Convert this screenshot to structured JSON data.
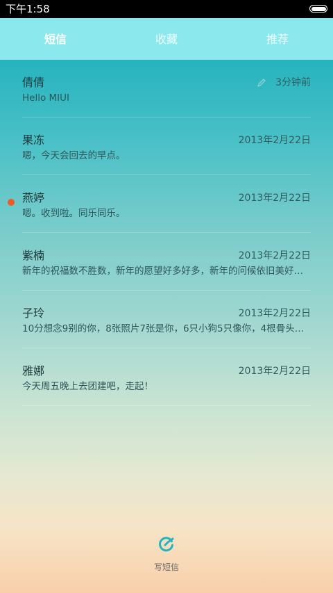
{
  "status_bar": {
    "time": "下午1:58"
  },
  "tabs": [
    {
      "label": "短信",
      "active": true
    },
    {
      "label": "收藏",
      "active": false
    },
    {
      "label": "推荐",
      "active": false
    }
  ],
  "messages": [
    {
      "name": "倩倩",
      "preview": "Hello MIUI",
      "date": "3分钟前",
      "draft": true,
      "unread": false
    },
    {
      "name": "果冻",
      "preview": "嗯，今天会回去的早点。",
      "date": "2013年2月22日",
      "draft": false,
      "unread": false
    },
    {
      "name": "燕婷",
      "preview": "嗯。收到啦。同乐同乐。",
      "date": "2013年2月22日",
      "draft": false,
      "unread": true
    },
    {
      "name": "紫楠",
      "preview": "新年的祝福数不胜数，新年的愿望好多好多，新年的问候依旧美好…",
      "date": "2013年2月22日",
      "draft": false,
      "unread": false
    },
    {
      "name": "子玲",
      "preview": "10分想念9别的你，8张照片7张是你，6只小狗5只像你，4根骨头…",
      "date": "2013年2月22日",
      "draft": false,
      "unread": false
    },
    {
      "name": "雅娜",
      "preview": "今天周五晚上去团建吧，走起！",
      "date": "2013年2月22日",
      "draft": false,
      "unread": false
    }
  ],
  "compose": {
    "label": "写短信",
    "icon": "compose-icon"
  },
  "colors": {
    "accent": "#1fb5c1",
    "tab_bar": "#8be9ee",
    "unread_dot": "#f15a24"
  }
}
